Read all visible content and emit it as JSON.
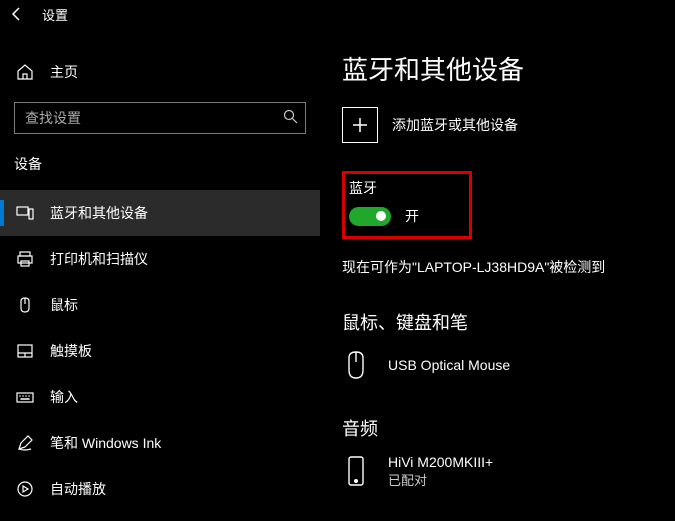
{
  "titlebar": {
    "app_name": "设置"
  },
  "sidebar": {
    "home_label": "主页",
    "search_placeholder": "查找设置",
    "section_label": "设备",
    "items": [
      {
        "label": "蓝牙和其他设备"
      },
      {
        "label": "打印机和扫描仪"
      },
      {
        "label": "鼠标"
      },
      {
        "label": "触摸板"
      },
      {
        "label": "输入"
      },
      {
        "label": "笔和 Windows Ink"
      },
      {
        "label": "自动播放"
      }
    ]
  },
  "page": {
    "title": "蓝牙和其他设备",
    "add_device_label": "添加蓝牙或其他设备",
    "bluetooth": {
      "label": "蓝牙",
      "state": "开"
    },
    "discoverable": "现在可作为\"LAPTOP-LJ38HD9A\"被检测到",
    "sections": {
      "mouse_kbd_pen": {
        "title": "鼠标、键盘和笔",
        "device": {
          "name": "USB Optical Mouse",
          "status": ""
        }
      },
      "audio": {
        "title": "音频",
        "device": {
          "name": "HiVi M200MKIII+",
          "status": "已配对"
        }
      }
    }
  }
}
